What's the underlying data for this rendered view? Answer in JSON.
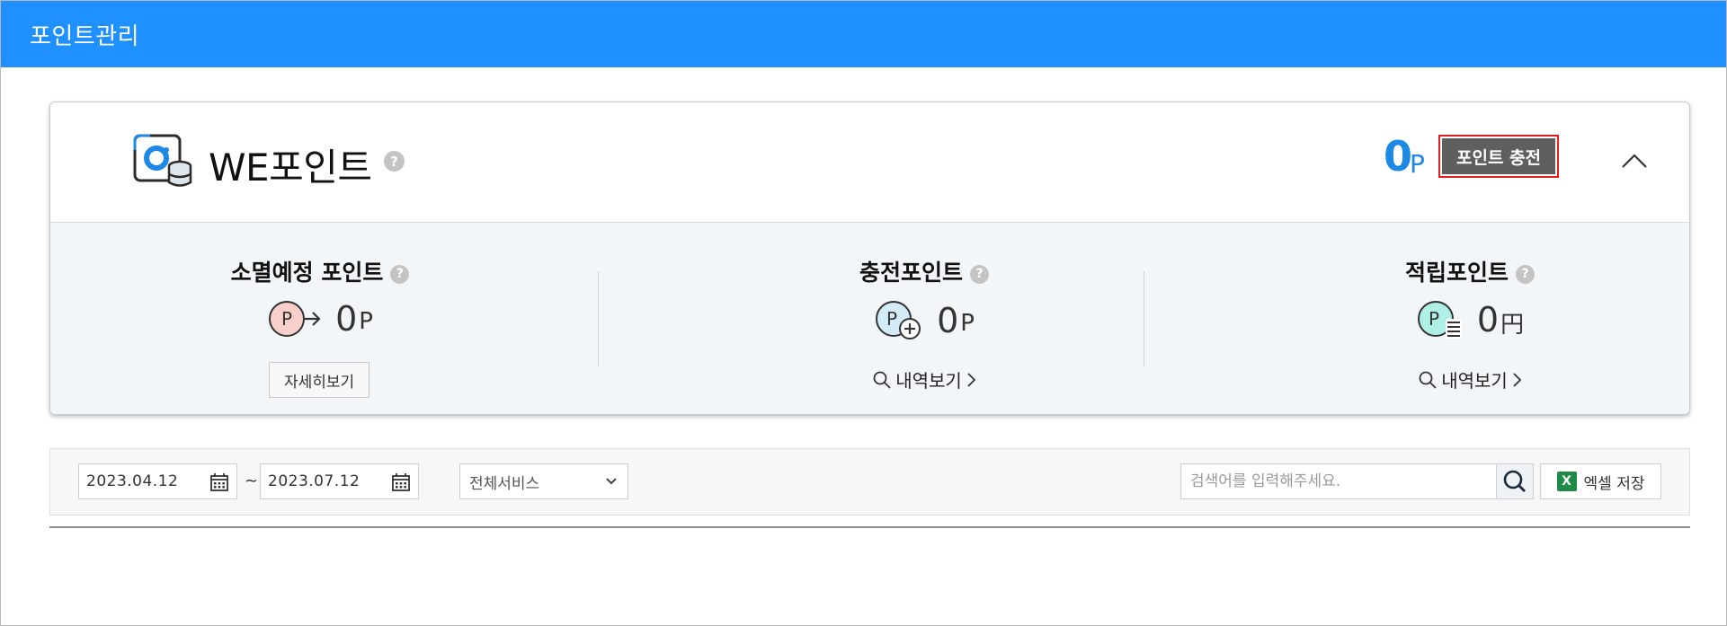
{
  "page": {
    "title": "포인트관리"
  },
  "wepoint": {
    "title": "WE포인트",
    "total_value": "0",
    "total_unit": "P",
    "charge_label": "포인트 충전",
    "help": "?"
  },
  "stats": {
    "expiring": {
      "title": "소멸예정 포인트",
      "value": "0",
      "unit": "P",
      "detail_label": "자세히보기"
    },
    "charged": {
      "title": "충전포인트",
      "value": "0",
      "unit": "P",
      "history_label": "내역보기"
    },
    "earned": {
      "title": "적립포인트",
      "value": "0",
      "unit": "円",
      "history_label": "내역보기"
    }
  },
  "filter": {
    "start_date": "2023.04.12",
    "tilde": "~",
    "end_date": "2023.07.12",
    "service_selected": "전체서비스",
    "search_placeholder": "검색어를 입력해주세요.",
    "excel_label": "엑셀 저장",
    "excel_icon_letter": "X"
  },
  "icons": {
    "brand": "wepoint-logo-icon",
    "expiring": "point-expire-icon",
    "charged": "point-charge-icon",
    "earned": "point-earn-icon",
    "calendar": "calendar-icon",
    "search": "search-icon",
    "excel": "excel-icon",
    "chevron_up": "chevron-up-icon",
    "chevron_down": "chevron-down-icon"
  },
  "colors": {
    "titlebar": "#1e90ff",
    "accent_blue": "#1e88e5",
    "charge_button": "#5f5f5f",
    "highlight_border": "#e21f1f",
    "excel_green": "#1f8a47"
  }
}
